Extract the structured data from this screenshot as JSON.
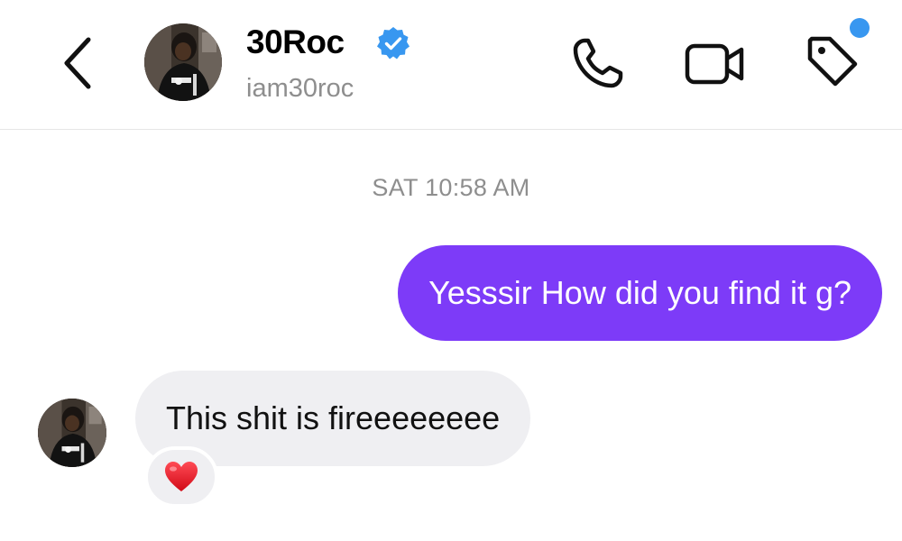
{
  "header": {
    "name": "30Roc",
    "handle": "iam30roc",
    "verified": true,
    "icons": {
      "back": "chevron-left-icon",
      "verified": "verified-badge-icon",
      "call": "phone-icon",
      "video": "video-camera-icon",
      "tag": "tag-icon"
    },
    "notification_dot": true
  },
  "thread": {
    "timestamp": "SAT 10:58 AM",
    "messages": [
      {
        "direction": "outgoing",
        "text": "Yesssir How did you find it g?"
      },
      {
        "direction": "incoming",
        "text": "This shit is fireeeeeeee",
        "reaction": "❤️"
      }
    ]
  },
  "colors": {
    "outgoing_bubble": "#7d3bf8",
    "incoming_bubble": "#efeff2",
    "verified_badge": "#3897f0",
    "notification_dot": "#3897f0",
    "secondary_text": "#8e8e8e",
    "heart": "#e0101e"
  }
}
